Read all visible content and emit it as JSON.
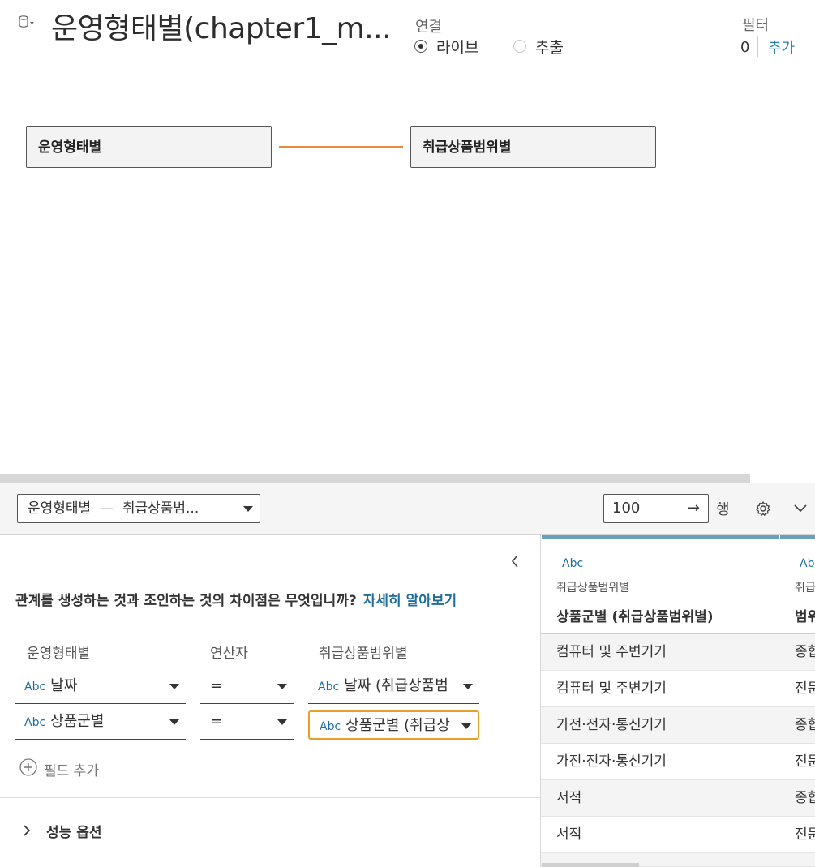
{
  "header": {
    "title": "운영형태별(chapter1_m...",
    "connection": {
      "label": "연결",
      "live": "라이브",
      "extract": "추출",
      "selected": "라이브"
    },
    "filters": {
      "label": "필터",
      "count": "0",
      "add": "추가"
    }
  },
  "canvas": {
    "tables": [
      "운영형태별",
      "취급상품범위별"
    ],
    "relationship_color": "#e8893c"
  },
  "toolbar": {
    "relationship_select": "운영형태별  —  취급상품범...",
    "rows_value": "100",
    "rows_arrow": "→",
    "rows_label": "행"
  },
  "relationship_editor": {
    "question": "관계를 생성하는 것과 조인하는 것의 차이점은 무엇입니까?",
    "learn_more": "자세히 알아보기",
    "headers": {
      "left": "운영형태별",
      "operator": "연산자",
      "right": "취급상품범위별"
    },
    "type_label": "Abc",
    "rows": [
      {
        "left": "날짜",
        "operator": "=",
        "right": "날짜 (취급상품범"
      },
      {
        "left": "상품군별",
        "operator": "=",
        "right": "상품군별 (취급상"
      }
    ],
    "add_field": "필드 추가",
    "performance_options": "성능 옵션"
  },
  "grid": {
    "columns": [
      {
        "type": "Abc",
        "source": "취급상품범위별",
        "name": "상품군별 (취급상품범위별)"
      },
      {
        "type": "Abc",
        "source": "취급",
        "name": "범위"
      }
    ],
    "rows": [
      [
        "컴퓨터 및 주변기기",
        "종합"
      ],
      [
        "컴퓨터 및 주변기기",
        "전문"
      ],
      [
        "가전·전자·통신기기",
        "종합"
      ],
      [
        "가전·전자·통신기기",
        "전문"
      ],
      [
        "서적",
        "종합"
      ],
      [
        "서적",
        "전문"
      ]
    ]
  }
}
